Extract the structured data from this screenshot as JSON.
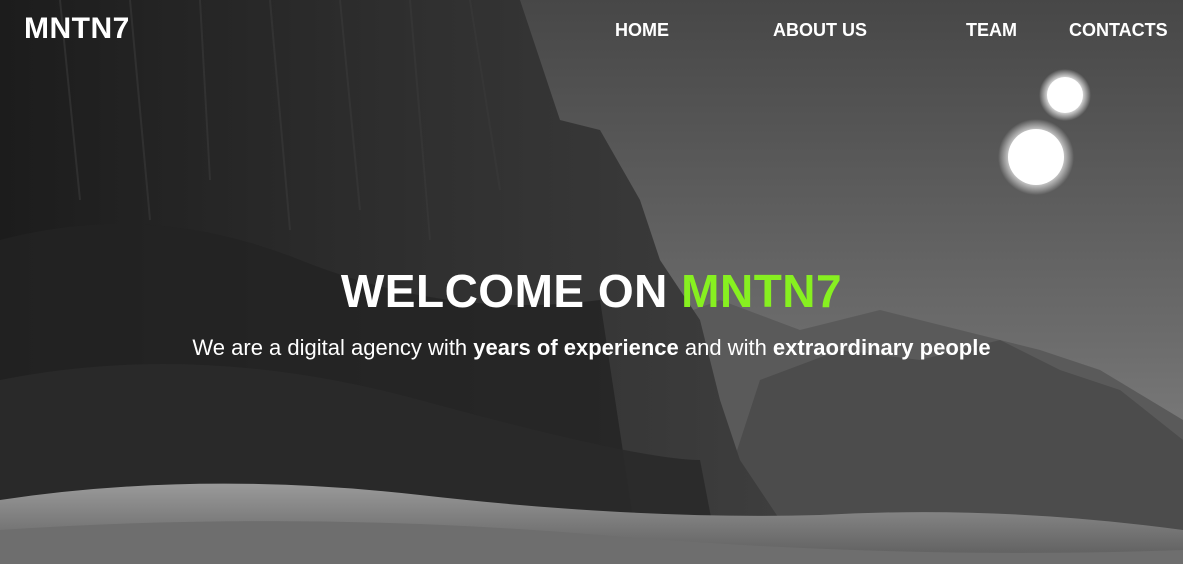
{
  "brand": {
    "logo": "MNTN7"
  },
  "nav": {
    "items": [
      {
        "label": "HOME"
      },
      {
        "label": "ABOUT US"
      },
      {
        "label": "TEAM"
      },
      {
        "label": "CONTACTS"
      }
    ]
  },
  "hero": {
    "heading_prefix": "WELCOME ON ",
    "heading_accent": "MNTN7",
    "tagline_part1": "We are a digital agency with ",
    "tagline_bold1": "years of experience",
    "tagline_part2": " and with ",
    "tagline_bold2": "extraordinary people"
  },
  "colors": {
    "accent": "#87f020",
    "text": "#ffffff"
  }
}
